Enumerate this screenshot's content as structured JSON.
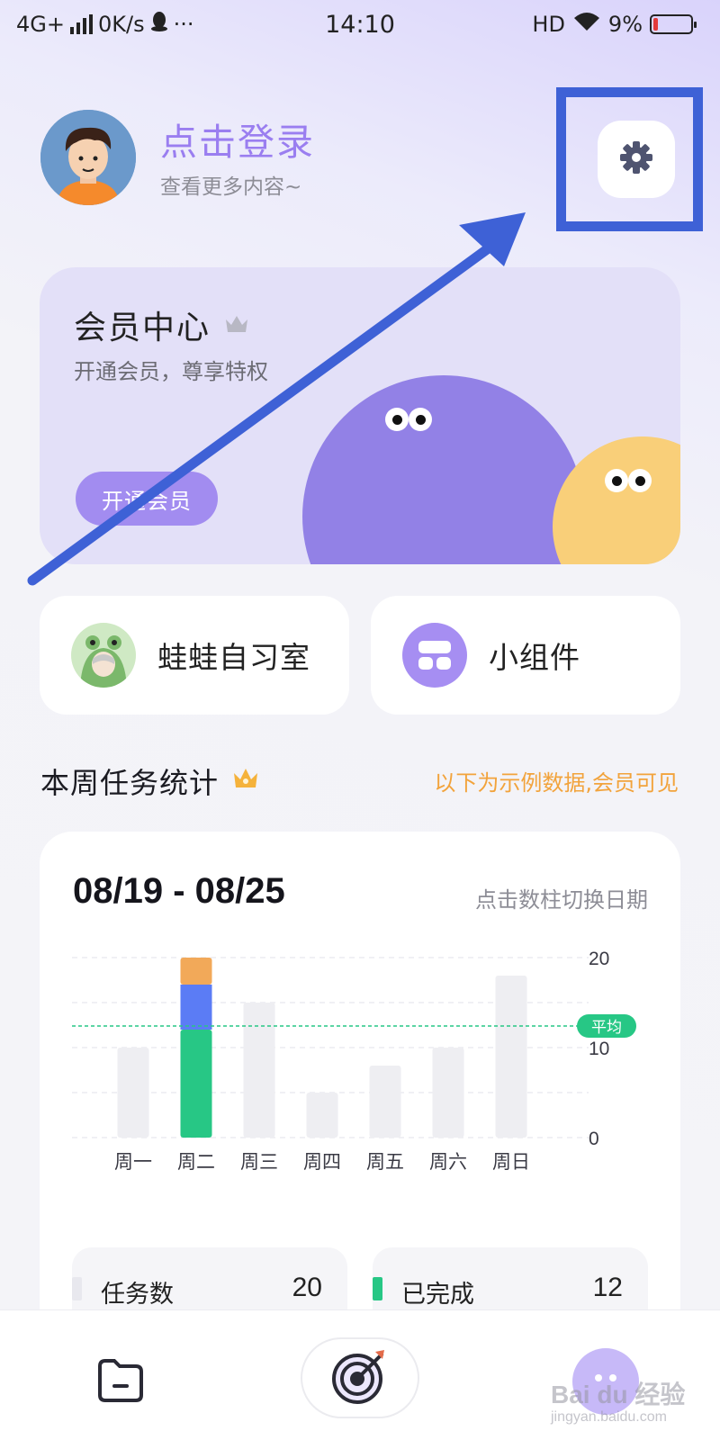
{
  "status_bar": {
    "network": "4G+",
    "speed": "0K/s",
    "more": "···",
    "time": "14:10",
    "hd": "HD",
    "battery": "9%"
  },
  "profile": {
    "login_title": "点击登录",
    "login_sub": "查看更多内容~"
  },
  "member_card": {
    "title": "会员中心",
    "subtitle": "开通会员，尊享特权",
    "button": "开通会员"
  },
  "quick_cards": [
    {
      "label": "蛙蛙自习室"
    },
    {
      "label": "小组件"
    }
  ],
  "weekly_stats": {
    "title": "本周任务统计",
    "note": "以下为示例数据,会员可见",
    "date_range": "08/19 - 08/25",
    "hint": "点击数柱切换日期",
    "summary": [
      {
        "label": "任务数",
        "value": "20"
      },
      {
        "label": "已完成",
        "value": "12"
      }
    ]
  },
  "chart_data": {
    "type": "bar",
    "categories": [
      "周一",
      "周二",
      "周三",
      "周四",
      "周五",
      "周六",
      "周日"
    ],
    "values": [
      10,
      20,
      15,
      5,
      8,
      10,
      18
    ],
    "stacked_selected": {
      "category": "周二",
      "segments": [
        {
          "value": 12,
          "color": "#27c785"
        },
        {
          "value": 5,
          "color": "#5b7cf5"
        },
        {
          "value": 3,
          "color": "#f2a959"
        }
      ]
    },
    "average": 12.4,
    "average_label": "平均",
    "yticks": [
      0,
      10,
      20
    ],
    "ylim": [
      0,
      20
    ],
    "bar_color": "#eeeef2",
    "grid": true
  },
  "colors": {
    "accent": "#9a7ef0",
    "highlight": "#3e61d6",
    "note": "#f2a33c",
    "completed": "#27c785"
  },
  "watermark": {
    "text": "Bai du 经验",
    "sub": "jingyan.baidu.com"
  }
}
